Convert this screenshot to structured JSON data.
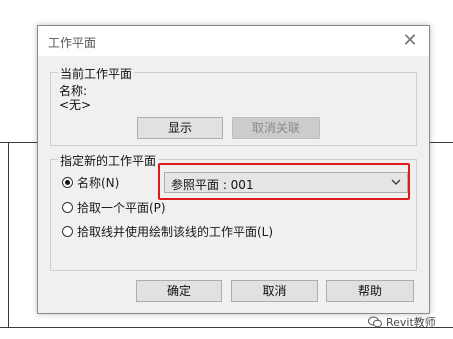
{
  "dialog": {
    "title": "工作平面",
    "close_glyph": "✕",
    "current_group": {
      "title": "当前工作平面",
      "name_label": "名称:",
      "name_value": "<无>",
      "show_button": "显示",
      "disassociate_button": "取消关联"
    },
    "new_group": {
      "title": "指定新的工作平面",
      "options": [
        {
          "label": "名称(N)",
          "selected": true
        },
        {
          "label": "拾取一个平面(P)",
          "selected": false
        },
        {
          "label": "拾取线并使用绘制该线的工作平面(L)",
          "selected": false
        }
      ],
      "name_select_value": "参照平面 : 001"
    },
    "buttons": {
      "ok": "确定",
      "cancel": "取消",
      "help": "帮助"
    }
  },
  "watermark": {
    "text": "Revit教师",
    "icon": "wechat-icon"
  },
  "colors": {
    "highlight": "#e01a1a",
    "dialog_bg": "#f0f0f0"
  }
}
